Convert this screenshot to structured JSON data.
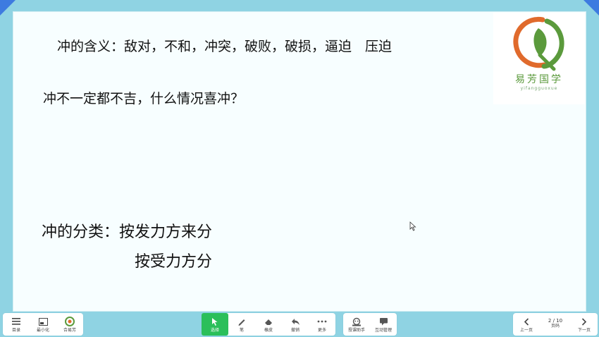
{
  "slide": {
    "line1": "冲的含义：敌对，不和，冲突，破败，破损，逼迫　压迫",
    "line2": "冲不一定都不吉，什么情况喜冲？",
    "line3": "冲的分类：按发力方来分",
    "line4": "按受力方分"
  },
  "logo": {
    "name": "易芳国学",
    "sub": "yifangguoxue"
  },
  "toolbar": {
    "left": [
      {
        "label": "目录",
        "icon": "menu-icon"
      },
      {
        "label": "最小化",
        "icon": "minimize-icon"
      },
      {
        "label": "合易芳",
        "icon": "logo-icon"
      }
    ],
    "tools": [
      {
        "label": "选择",
        "icon": "pointer-icon"
      },
      {
        "label": "笔",
        "icon": "pen-icon"
      },
      {
        "label": "橡皮",
        "icon": "eraser-icon"
      },
      {
        "label": "撤销",
        "icon": "undo-icon"
      },
      {
        "label": "更多",
        "icon": "more-icon"
      }
    ],
    "extra": [
      {
        "label": "授课助手",
        "icon": "assistant-icon"
      },
      {
        "label": "互动管理",
        "icon": "chat-icon"
      }
    ],
    "nav": {
      "prev": "上一页",
      "page": "2 / 10",
      "page_label": "页码",
      "next": "下一页"
    }
  },
  "colors": {
    "background": "#8fd3e3",
    "corner": "#3d7be0",
    "active_tool": "#2bbf5a",
    "logo_green": "#5b9a3c",
    "logo_orange": "#e06a2c"
  }
}
